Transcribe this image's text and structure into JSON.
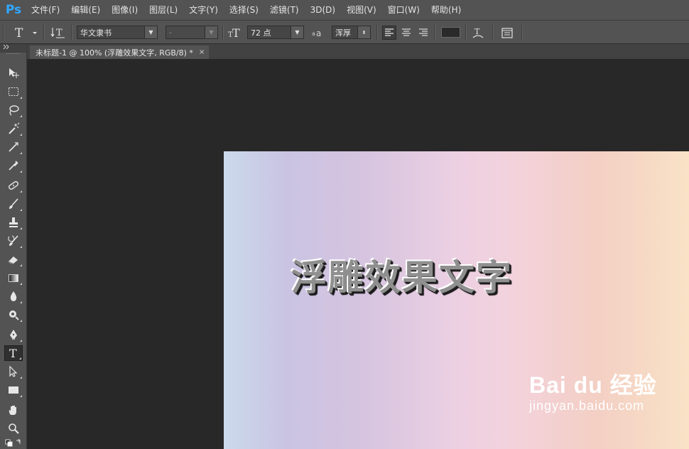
{
  "app": {
    "logo": "Ps"
  },
  "menu": [
    "文件(F)",
    "编辑(E)",
    "图像(I)",
    "图层(L)",
    "文字(Y)",
    "选择(S)",
    "滤镜(T)",
    "3D(D)",
    "视图(V)",
    "窗口(W)",
    "帮助(H)"
  ],
  "options": {
    "tool_icon": "text-tool-icon",
    "font_family": "华文隶书",
    "font_style": "-",
    "font_size": "72 点",
    "antialias": "浑厚",
    "text_color": "#2a2a2a"
  },
  "document": {
    "tab_title": "未标题-1 @ 100% (浮雕效果文字, RGB/8) *",
    "close": "×"
  },
  "tools": [
    "move-tool-icon",
    "marquee-tool-icon",
    "lasso-tool-icon",
    "magic-wand-tool-icon",
    "crop-tool-icon",
    "eyedropper-tool-icon",
    "healing-brush-tool-icon",
    "brush-tool-icon",
    "clone-stamp-tool-icon",
    "history-brush-tool-icon",
    "eraser-tool-icon",
    "gradient-tool-icon",
    "blur-tool-icon",
    "dodge-tool-icon",
    "pen-tool-icon",
    "type-tool-icon",
    "path-selection-tool-icon",
    "rectangle-tool-icon",
    "hand-tool-icon",
    "zoom-tool-icon"
  ],
  "canvas": {
    "text": "浮雕效果文字"
  },
  "watermark": {
    "brand": "Bai du 经验",
    "url": "jingyan.baidu.com"
  }
}
